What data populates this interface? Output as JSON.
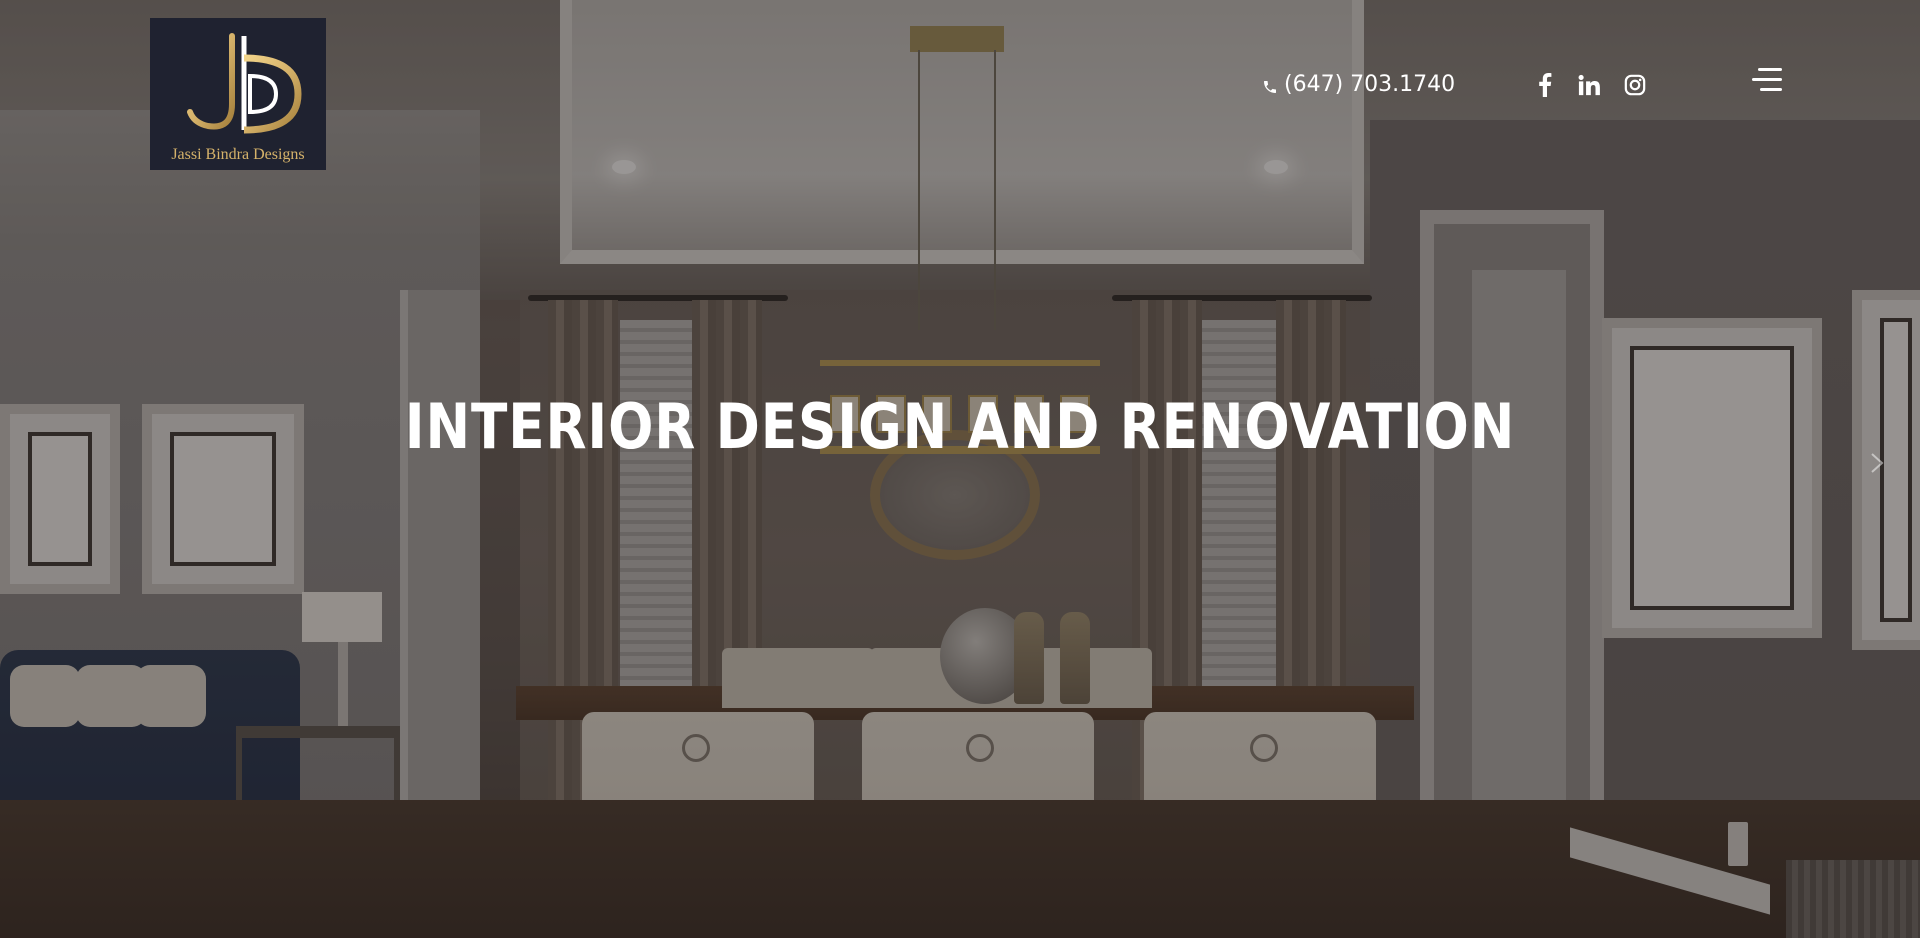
{
  "brand": {
    "logo_text": "Jassi Bindra Designs",
    "logo_colors": {
      "background": "#1f2230",
      "gold": "#d5b26a"
    }
  },
  "header": {
    "phone_icon": "phone-icon",
    "phone_number": "(647) 703.1740",
    "social_links": [
      {
        "name": "facebook-icon"
      },
      {
        "name": "linkedin-icon"
      },
      {
        "name": "instagram-icon"
      }
    ],
    "menu_icon": "hamburger-menu-icon"
  },
  "hero": {
    "title": "INTERIOR DESIGN AND RENOVATION",
    "next_icon": "chevron-right-icon"
  },
  "colors": {
    "text": "#ffffff",
    "accent": "#d5b26a"
  }
}
